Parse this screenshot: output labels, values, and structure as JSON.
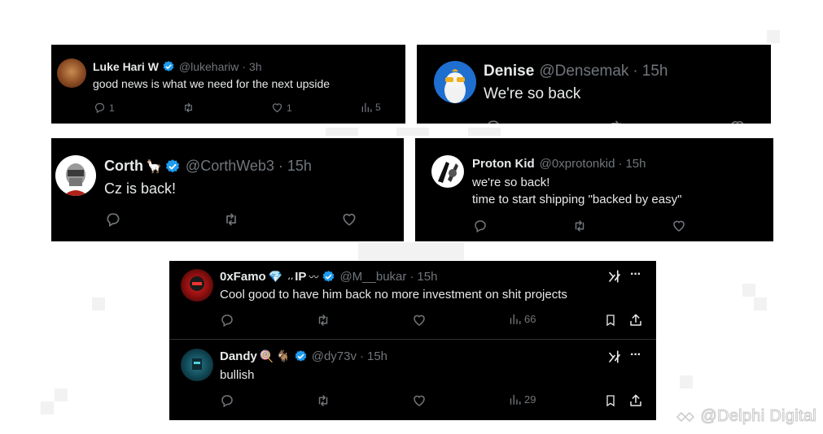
{
  "tweets": [
    {
      "name": "Luke Hari W",
      "handle": "@lukehariw",
      "dot": "·",
      "time": "3h",
      "text": "good news is what we need for the next upside",
      "reply_count": "1",
      "like_count": "1",
      "view_count": "5"
    },
    {
      "name": "Denise",
      "handle": "@Densemak",
      "dot": "·",
      "time": "15h",
      "text": "We're so back"
    },
    {
      "name": "Corth",
      "handle": "@CorthWeb3",
      "dot": "·",
      "time": "15h",
      "text": "Cz is back!"
    },
    {
      "name": "Proton Kid",
      "handle": "@0xprotonkid",
      "dot": "·",
      "time": "15h",
      "text_line1": "we're so back!",
      "text_line2": "time to start shipping \"backed by easy\""
    },
    {
      "name": "0xFamo",
      "name_suffix": "IP",
      "handle": "@M__bukar",
      "dot": "·",
      "time": "15h",
      "text": "Cool good to have him back no more investment on shit projects",
      "view_count": "66"
    },
    {
      "name": "Dandy",
      "handle": "@dy73v",
      "dot": "·",
      "time": "15h",
      "text": "bullish",
      "view_count": "29"
    }
  ],
  "more_label": "···",
  "watermark": "@Delphi Digital",
  "colors": {
    "card_bg": "#000000",
    "text": "#e7e9ea",
    "muted": "#71767b",
    "verified": "#1d9bf0",
    "page_bg": "#ffffff"
  }
}
